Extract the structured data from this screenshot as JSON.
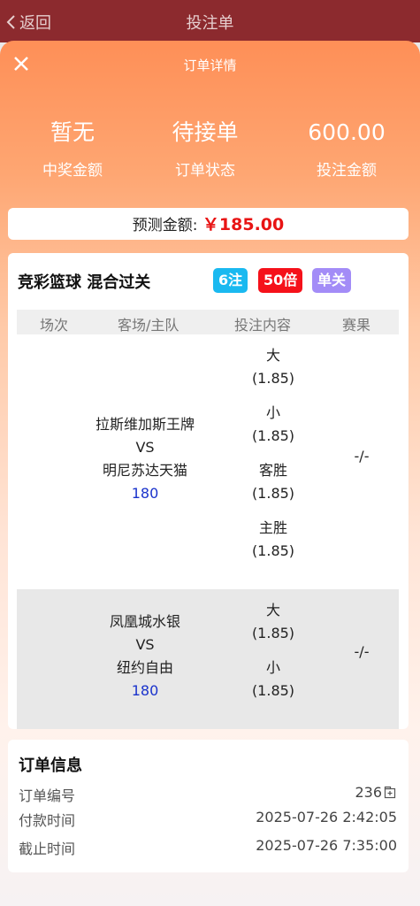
{
  "topbar": {
    "back_label": "返回",
    "title": "投注单"
  },
  "detail": {
    "title": "订单详情"
  },
  "stats": [
    {
      "value": "暂无",
      "label": "中奖金额"
    },
    {
      "value": "待接单",
      "label": "订单状态"
    },
    {
      "value": "600.00",
      "label": "投注金额"
    }
  ],
  "predict": {
    "label": "预测金额: ",
    "amount": "￥185.00"
  },
  "ticket": {
    "title": "竞彩篮球 混合过关",
    "badges": [
      "6注",
      "50倍",
      "单关"
    ],
    "columns": [
      "场次",
      "客场/主队",
      "投注内容",
      "赛果"
    ],
    "matches": [
      {
        "away": "拉斯维加斯王牌",
        "vs": "VS",
        "home": "明尼苏达天猫",
        "line": "180",
        "bets": [
          {
            "name": "大",
            "odds": "(1.85)"
          },
          {
            "name": "小",
            "odds": "(1.85)"
          },
          {
            "name": "客胜",
            "odds": "(1.85)"
          },
          {
            "name": "主胜",
            "odds": "(1.85)"
          }
        ],
        "result": "-/-"
      },
      {
        "away": "凤凰城水银",
        "vs": "VS",
        "home": "纽约自由",
        "line": "180",
        "bets": [
          {
            "name": "大",
            "odds": "(1.85)"
          },
          {
            "name": "小",
            "odds": "(1.85)"
          }
        ],
        "result": "-/-"
      }
    ]
  },
  "order_info": {
    "title": "订单信息",
    "rows": [
      {
        "key": "订单编号",
        "value": "236"
      },
      {
        "key": "付款时间",
        "value": "2025-07-26 2:42:05"
      },
      {
        "key": "截止时间",
        "value": "2025-07-26 7:35:00"
      }
    ]
  },
  "colors": {
    "header": "#8c2a2e",
    "accent": "#fe8f57",
    "red": "#e81414",
    "blue_link": "#1a33cc"
  }
}
